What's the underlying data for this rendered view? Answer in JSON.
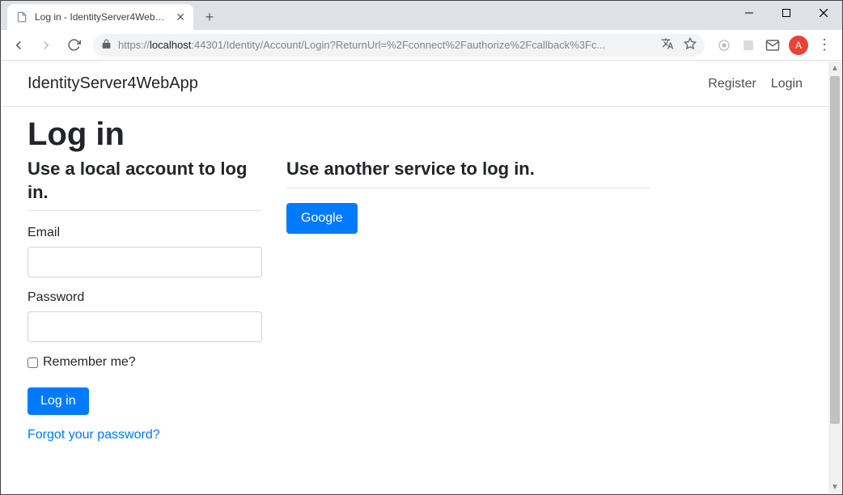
{
  "browser": {
    "tab_title": "Log in - IdentityServer4WebApp",
    "url_display_host": "localhost",
    "url_display_prefix": "https://",
    "url_display_port_path": ":44301/Identity/Account/Login?ReturnUrl=%2Fconnect%2Fauthorize%2Fcallback%3Fc...",
    "avatar_initial": "A"
  },
  "nav": {
    "brand": "IdentityServer4WebApp",
    "register": "Register",
    "login": "Login"
  },
  "page": {
    "heading": "Log in",
    "local_heading": "Use a local account to log in.",
    "external_heading": "Use another service to log in.",
    "email_label": "Email",
    "password_label": "Password",
    "remember_label": "Remember me?",
    "login_button": "Log in",
    "forgot_link": "Forgot your password?",
    "google_button": "Google"
  }
}
